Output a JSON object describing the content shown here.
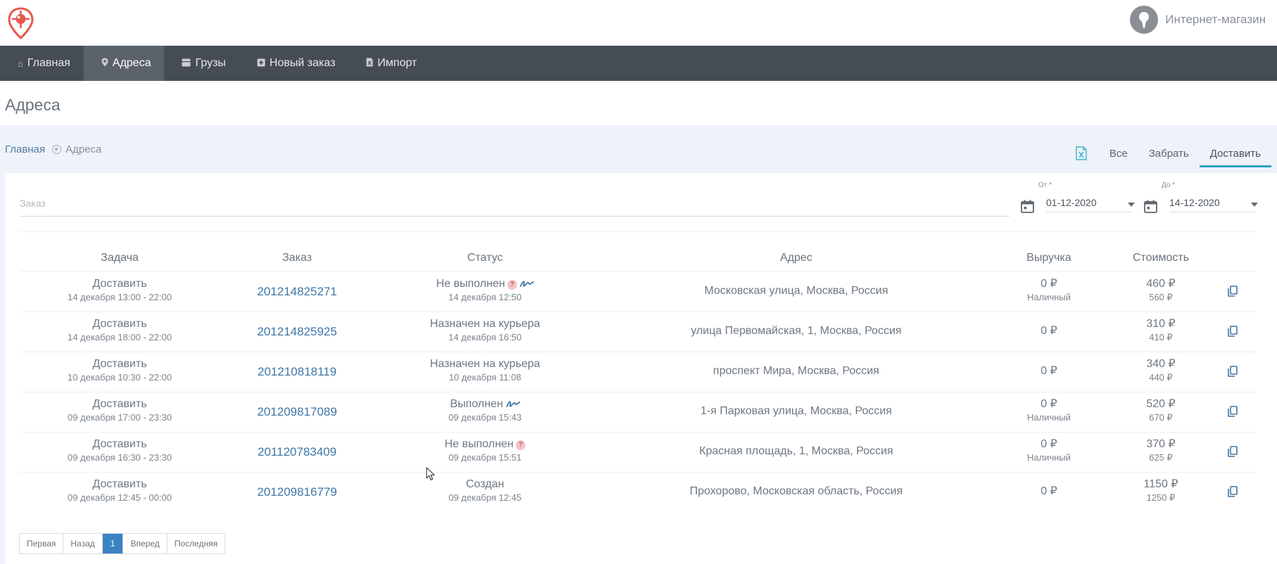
{
  "header": {
    "user_name": "Интернет-магазин"
  },
  "nav": [
    {
      "label": "Главная",
      "icon": "home-icon"
    },
    {
      "label": "Адреса",
      "icon": "map-pin-icon"
    },
    {
      "label": "Грузы",
      "icon": "box-icon"
    },
    {
      "label": "Новый заказ",
      "icon": "plus-square-icon"
    },
    {
      "label": "Импорт",
      "icon": "file-import-icon"
    }
  ],
  "page": {
    "title": "Адреса"
  },
  "breadcrumb": {
    "home": "Главная",
    "current": "Адреса"
  },
  "tabs": [
    "Все",
    "Забрать",
    "Доставить"
  ],
  "filters": {
    "order_placeholder": "Заказ",
    "from_label": "От *",
    "from_value": "01-12-2020",
    "to_label": "До *",
    "to_value": "14-12-2020"
  },
  "table": {
    "headers": [
      "Задача",
      "Заказ",
      "Статус",
      "Адрес",
      "Выручка",
      "Стоимость"
    ],
    "rows": [
      {
        "task": "Доставить",
        "task_time": "14 декабря 13:00 - 22:00",
        "order": "201214825271",
        "status": "Не выполнен",
        "status_time": "14 декабря 12:50",
        "address": "Московская улица, Москва, Россия",
        "revenue": "0 ₽",
        "payment": "Наличный",
        "cost": "460 ₽",
        "cost_sub": "560 ₽"
      },
      {
        "task": "Доставить",
        "task_time": "14 декабря 18:00 - 22:00",
        "order": "201214825925",
        "status": "Назначен на курьера",
        "status_time": "14 декабря 16:50",
        "address": "улица Первомайская, 1, Москва, Россия",
        "revenue": "0 ₽",
        "payment": "",
        "cost": "310 ₽",
        "cost_sub": "410 ₽"
      },
      {
        "task": "Доставить",
        "task_time": "10 декабря 10:30 - 22:00",
        "order": "201210818119",
        "status": "Назначен на курьера",
        "status_time": "10 декабря 11:08",
        "address": "проспект Мира, Москва, Россия",
        "revenue": "0 ₽",
        "payment": "",
        "cost": "340 ₽",
        "cost_sub": "440 ₽"
      },
      {
        "task": "Доставить",
        "task_time": "09 декабря 17:00 - 23:30",
        "order": "201209817089",
        "status": "Выполнен",
        "status_time": "09 декабря 15:43",
        "address": "1-я Парковая улица, Москва, Россия",
        "revenue": "0 ₽",
        "payment": "Наличный",
        "cost": "520 ₽",
        "cost_sub": "670 ₽"
      },
      {
        "task": "Доставить",
        "task_time": "09 декабря 16:30 - 23:30",
        "order": "201120783409",
        "status": "Не выполнен",
        "status_time": "09 декабря 15:51",
        "address": "Красная площадь, 1, Москва, Россия",
        "revenue": "0 ₽",
        "payment": "Наличный",
        "cost": "370 ₽",
        "cost_sub": "625 ₽"
      },
      {
        "task": "Доставить",
        "task_time": "09 декабря 12:45 - 00:00",
        "order": "201209816779",
        "status": "Создан",
        "status_time": "09 декабря 12:45",
        "address": "Прохорово, Московская область, Россия",
        "revenue": "0 ₽",
        "payment": "",
        "cost": "1150 ₽",
        "cost_sub": "1250 ₽"
      }
    ]
  },
  "pagination": [
    "Первая",
    "Назад",
    "1",
    "Вперед",
    "Последняя"
  ],
  "colors": {
    "nav_bg": "#464c56",
    "nav_active": "#5b626c",
    "link": "#3f76a8",
    "tab_underline": "#2ea3c5",
    "page_active": "#3b82c4",
    "logo": "#e8574c"
  }
}
